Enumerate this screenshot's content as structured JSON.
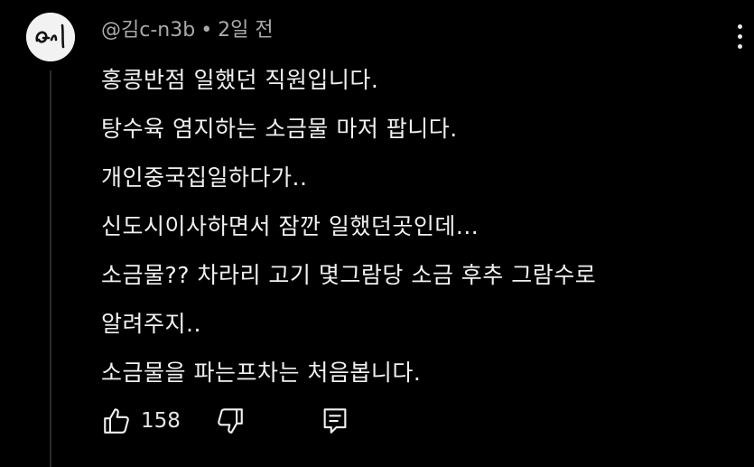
{
  "comment": {
    "author": "@김c-n3b",
    "separator": "•",
    "time": "2일 전",
    "lines": [
      "홍콩반점 일했던 직원입니다.",
      "탕수육 염지하는 소금물 마저 팝니다.",
      "개인중국집일하다가..",
      "신도시이사하면서 잠깐 일했던곳인데...",
      "소금물?? 차라리 고기 몇그람당 소금 후추 그람수로",
      "알려주지..",
      "소금물을 파는프차는 처음봅니다."
    ],
    "likes": "158"
  },
  "icons": {
    "like": "thumbs-up-icon",
    "dislike": "thumbs-down-icon",
    "reply": "reply-icon",
    "menu": "more-vertical-icon"
  },
  "colors": {
    "background": "#000000",
    "text": "#f1f1f1",
    "meta": "#aaaaaa"
  }
}
